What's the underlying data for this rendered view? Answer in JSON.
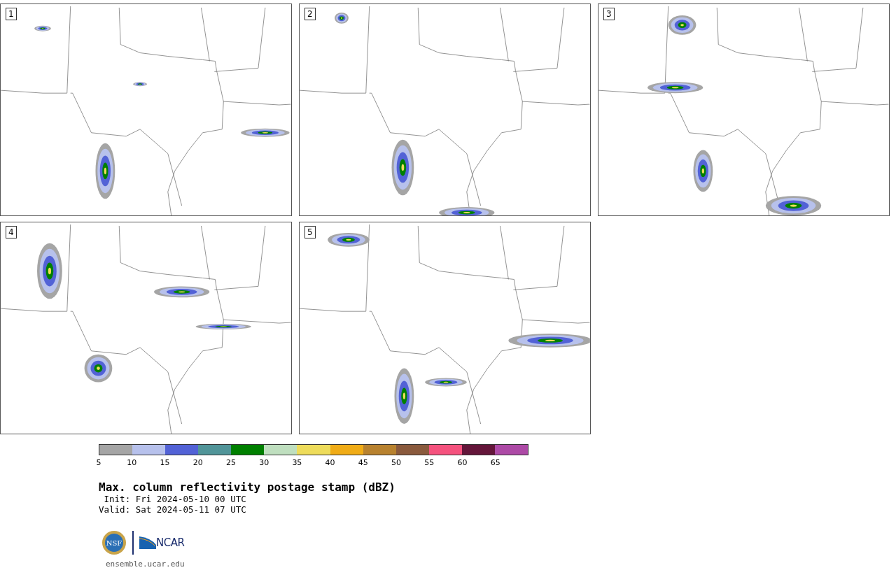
{
  "panels": [
    {
      "label": "1"
    },
    {
      "label": "2"
    },
    {
      "label": "3"
    },
    {
      "label": "4"
    },
    {
      "label": "5"
    }
  ],
  "colorbar": {
    "segments": [
      {
        "color": "#a5a5a5"
      },
      {
        "color": "#b7c1ec"
      },
      {
        "color": "#5262d6"
      },
      {
        "color": "#519599"
      },
      {
        "color": "#008000"
      },
      {
        "color": "#bfdfbf"
      },
      {
        "color": "#eedc5b"
      },
      {
        "color": "#f0ac17"
      },
      {
        "color": "#b8822f"
      },
      {
        "color": "#8a5a3d"
      },
      {
        "color": "#f5527e"
      },
      {
        "color": "#64163a"
      },
      {
        "color": "#ad4aa6"
      }
    ],
    "ticks": [
      "5",
      "10",
      "15",
      "20",
      "25",
      "30",
      "35",
      "40",
      "45",
      "50",
      "55",
      "60",
      "65"
    ]
  },
  "title": "Max. column reflectivity postage stamp (dBZ)",
  "init": " Init: Fri 2024-05-10 00 UTC",
  "valid": "Valid: Sat 2024-05-11 07 UTC",
  "logos": {
    "ncar": "NCAR",
    "nsf": "NSF"
  },
  "footer_url": "ensemble.ucar.edu"
}
